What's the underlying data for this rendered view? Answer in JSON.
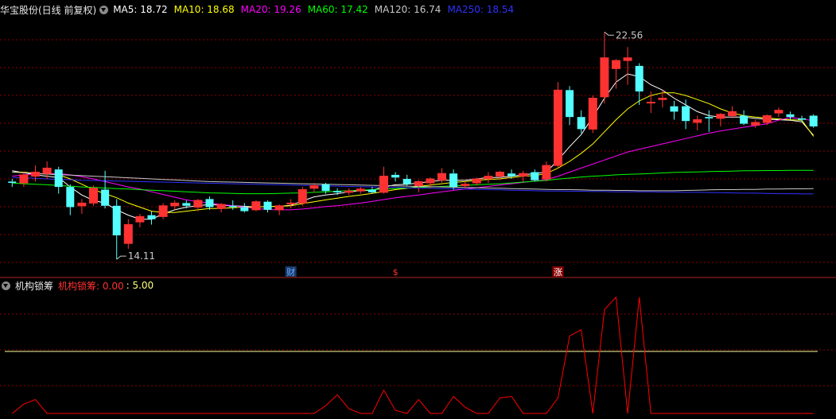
{
  "header": {
    "title": "华宝股份(日线 前复权)",
    "ma": [
      {
        "label": "MA5: 18.72",
        "color": "#ffffff"
      },
      {
        "label": "MA10: 18.68",
        "color": "#ffff00"
      },
      {
        "label": "MA20: 19.26",
        "color": "#ff00ff"
      },
      {
        "label": "MA60: 17.42",
        "color": "#00ff00"
      },
      {
        "label": "MA120: 16.74",
        "color": "#c8c8c8"
      },
      {
        "label": "MA250: 18.54",
        "color": "#3030ff"
      }
    ]
  },
  "annotations": {
    "high": "22.56",
    "low": "14.11",
    "markers": [
      "财",
      "$",
      "涨"
    ]
  },
  "indicator": {
    "name": "机构锁筹",
    "value_label": "机构锁筹: 0.00",
    "ref_label": ": 5.00"
  },
  "colors": {
    "up": "#ff3232",
    "down": "#54ffff",
    "grid": "#8b0000",
    "divider": "#b22222",
    "ind_line": "#ff0000",
    "ref_line": "#ffff99"
  },
  "chart_data": [
    {
      "type": "candlestick",
      "title": "华宝股份(日线 前复权)",
      "ohlc": [
        [
          17.0,
          17.1,
          16.8,
          16.95
        ],
        [
          16.95,
          17.35,
          16.8,
          17.25
        ],
        [
          17.2,
          17.6,
          17.0,
          17.35
        ],
        [
          17.3,
          17.75,
          17.1,
          17.5
        ],
        [
          17.45,
          17.55,
          16.55,
          16.8
        ],
        [
          16.8,
          16.9,
          15.75,
          16.05
        ],
        [
          16.1,
          16.35,
          15.8,
          16.2
        ],
        [
          16.2,
          16.85,
          16.1,
          16.75
        ],
        [
          16.7,
          17.4,
          16.0,
          16.1
        ],
        [
          16.1,
          16.35,
          14.11,
          15.0
        ],
        [
          14.7,
          15.6,
          14.5,
          15.4
        ],
        [
          15.5,
          15.8,
          15.3,
          15.7
        ],
        [
          15.75,
          15.9,
          15.4,
          15.6
        ],
        [
          15.7,
          16.2,
          15.6,
          16.1
        ],
        [
          16.1,
          16.3,
          15.95,
          16.2
        ],
        [
          16.2,
          16.3,
          16.0,
          16.1
        ],
        [
          16.05,
          16.35,
          15.9,
          16.3
        ],
        [
          16.35,
          16.45,
          15.95,
          16.05
        ],
        [
          16.0,
          16.2,
          15.85,
          16.15
        ],
        [
          16.1,
          16.3,
          15.95,
          16.05
        ],
        [
          16.05,
          16.2,
          15.85,
          15.9
        ],
        [
          15.95,
          16.3,
          15.9,
          16.25
        ],
        [
          16.25,
          16.3,
          15.85,
          15.95
        ],
        [
          15.95,
          16.15,
          15.75,
          16.1
        ],
        [
          16.2,
          16.35,
          16.0,
          16.2
        ],
        [
          16.2,
          16.8,
          16.1,
          16.7
        ],
        [
          16.75,
          16.95,
          16.6,
          16.85
        ],
        [
          16.9,
          16.95,
          16.55,
          16.65
        ],
        [
          16.65,
          16.75,
          16.5,
          16.6
        ],
        [
          16.6,
          16.75,
          16.5,
          16.65
        ],
        [
          16.65,
          16.8,
          16.55,
          16.72
        ],
        [
          16.7,
          16.8,
          16.55,
          16.6
        ],
        [
          16.6,
          17.55,
          16.55,
          17.2
        ],
        [
          17.25,
          17.35,
          17.0,
          17.15
        ],
        [
          17.1,
          17.25,
          16.85,
          16.9
        ],
        [
          16.85,
          17.05,
          16.6,
          17.0
        ],
        [
          16.95,
          17.15,
          16.75,
          17.1
        ],
        [
          17.05,
          17.5,
          16.95,
          17.3
        ],
        [
          17.3,
          17.45,
          16.7,
          16.8
        ],
        [
          16.85,
          17.0,
          16.75,
          16.9
        ],
        [
          16.95,
          17.15,
          16.85,
          17.1
        ],
        [
          17.1,
          17.35,
          16.95,
          17.2
        ],
        [
          17.2,
          17.4,
          17.05,
          17.35
        ],
        [
          17.3,
          17.45,
          17.1,
          17.2
        ],
        [
          17.2,
          17.4,
          17.0,
          17.3
        ],
        [
          17.35,
          17.45,
          17.0,
          17.05
        ],
        [
          17.1,
          17.75,
          17.0,
          17.6
        ],
        [
          17.6,
          20.7,
          17.5,
          20.4
        ],
        [
          20.4,
          20.55,
          19.1,
          19.4
        ],
        [
          19.4,
          19.65,
          18.8,
          18.95
        ],
        [
          18.95,
          20.2,
          18.8,
          20.1
        ],
        [
          20.15,
          22.56,
          19.9,
          21.6
        ],
        [
          21.2,
          21.55,
          20.45,
          21.5
        ],
        [
          21.5,
          22.0,
          20.6,
          21.6
        ],
        [
          21.3,
          21.4,
          19.85,
          20.35
        ],
        [
          19.95,
          20.35,
          19.55,
          19.95
        ],
        [
          20.05,
          20.4,
          19.75,
          20.1
        ],
        [
          19.8,
          20.0,
          19.3,
          19.6
        ],
        [
          19.8,
          20.05,
          18.95,
          19.25
        ],
        [
          19.2,
          19.45,
          18.9,
          19.3
        ],
        [
          19.4,
          19.65,
          18.85,
          19.35
        ],
        [
          19.35,
          19.55,
          19.05,
          19.5
        ],
        [
          19.45,
          19.8,
          19.35,
          19.6
        ],
        [
          19.45,
          19.65,
          19.1,
          19.15
        ],
        [
          19.1,
          19.3,
          19.0,
          19.2
        ],
        [
          19.2,
          19.5,
          19.1,
          19.45
        ],
        [
          19.55,
          19.75,
          19.4,
          19.65
        ],
        [
          19.5,
          19.6,
          19.3,
          19.4
        ],
        [
          19.35,
          19.45,
          19.2,
          19.3
        ],
        [
          19.45,
          19.5,
          19.0,
          19.05
        ]
      ],
      "ma_lines": {
        "MA5": [
          17.4,
          17.33,
          17.25,
          17.2,
          17.15,
          16.8,
          16.5,
          16.3,
          16.2,
          15.95,
          15.75,
          15.6,
          15.6,
          15.8,
          15.95,
          16.05,
          16.1,
          16.15,
          16.12,
          16.1,
          16.08,
          16.06,
          16.07,
          16.08,
          16.12,
          16.28,
          16.43,
          16.5,
          16.55,
          16.62,
          16.66,
          16.68,
          16.8,
          16.88,
          16.9,
          16.95,
          17.0,
          17.05,
          17.05,
          17.05,
          17.1,
          17.15,
          17.15,
          17.2,
          17.25,
          17.3,
          17.35,
          17.8,
          18.3,
          18.75,
          19.4,
          20.1,
          20.7,
          21.0,
          20.9,
          20.6,
          20.4,
          20.1,
          19.85,
          19.6,
          19.45,
          19.4,
          19.4,
          19.4,
          19.35,
          19.32,
          19.3,
          19.28,
          19.22,
          18.72
        ],
        "MA10": [
          17.35,
          17.35,
          17.3,
          17.28,
          17.25,
          17.1,
          16.9,
          16.7,
          16.55,
          16.4,
          16.2,
          16.05,
          15.9,
          15.85,
          15.85,
          15.9,
          15.95,
          16.0,
          16.0,
          16.03,
          16.05,
          16.06,
          16.07,
          16.08,
          16.1,
          16.18,
          16.25,
          16.32,
          16.38,
          16.45,
          16.5,
          16.56,
          16.63,
          16.7,
          16.75,
          16.82,
          16.87,
          16.92,
          16.97,
          17.0,
          17.05,
          17.08,
          17.1,
          17.15,
          17.2,
          17.22,
          17.3,
          17.5,
          17.75,
          18.05,
          18.4,
          18.85,
          19.3,
          19.7,
          20.0,
          20.2,
          20.3,
          20.3,
          20.2,
          20.05,
          19.9,
          19.7,
          19.55,
          19.45,
          19.4,
          19.36,
          19.33,
          19.3,
          19.28,
          18.68
        ],
        "MA20": [
          17.2,
          17.25,
          17.28,
          17.3,
          17.3,
          17.25,
          17.18,
          17.1,
          17.0,
          16.9,
          16.8,
          16.72,
          16.62,
          16.52,
          16.42,
          16.32,
          16.25,
          16.2,
          16.15,
          16.1,
          16.05,
          16.0,
          15.96,
          15.95,
          15.95,
          15.98,
          16.02,
          16.07,
          16.1,
          16.15,
          16.2,
          16.26,
          16.33,
          16.4,
          16.45,
          16.5,
          16.56,
          16.62,
          16.67,
          16.72,
          16.77,
          16.82,
          16.87,
          16.92,
          16.97,
          17.02,
          17.07,
          17.2,
          17.35,
          17.5,
          17.65,
          17.8,
          17.95,
          18.1,
          18.2,
          18.3,
          18.4,
          18.5,
          18.6,
          18.7,
          18.8,
          18.88,
          18.95,
          19.02,
          19.08,
          19.15,
          19.28,
          19.38,
          19.33,
          19.26
        ],
        "MA60": [
          16.95,
          16.92,
          16.9,
          16.88,
          16.85,
          16.83,
          16.8,
          16.78,
          16.76,
          16.74,
          16.72,
          16.7,
          16.68,
          16.66,
          16.64,
          16.62,
          16.6,
          16.58,
          16.57,
          16.56,
          16.55,
          16.55,
          16.55,
          16.56,
          16.57,
          16.58,
          16.6,
          16.62,
          16.64,
          16.66,
          16.68,
          16.7,
          16.72,
          16.74,
          16.76,
          16.78,
          16.8,
          16.82,
          16.84,
          16.86,
          16.88,
          16.9,
          16.92,
          16.95,
          16.98,
          17.01,
          17.05,
          17.09,
          17.13,
          17.17,
          17.2,
          17.22,
          17.25,
          17.27,
          17.28,
          17.3,
          17.32,
          17.34,
          17.35,
          17.36,
          17.37,
          17.38,
          17.39,
          17.4,
          17.4,
          17.41,
          17.41,
          17.42,
          17.42,
          17.42
        ],
        "MA120": [
          17.35,
          17.33,
          17.3,
          17.28,
          17.26,
          17.24,
          17.22,
          17.2,
          17.18,
          17.16,
          17.14,
          17.12,
          17.1,
          17.08,
          17.06,
          17.04,
          17.02,
          17.0,
          16.99,
          16.98,
          16.97,
          16.96,
          16.95,
          16.94,
          16.93,
          16.92,
          16.91,
          16.9,
          16.89,
          16.88,
          16.87,
          16.86,
          16.85,
          16.84,
          16.83,
          16.82,
          16.81,
          16.8,
          16.79,
          16.78,
          16.77,
          16.76,
          16.75,
          16.74,
          16.73,
          16.72,
          16.71,
          16.7,
          16.7,
          16.69,
          16.68,
          16.68,
          16.67,
          16.67,
          16.66,
          16.66,
          16.66,
          16.66,
          16.67,
          16.68,
          16.69,
          16.7,
          16.7,
          16.71,
          16.71,
          16.72,
          16.72,
          16.73,
          16.73,
          16.74
        ],
        "MA250": [
          17.15,
          17.14,
          17.12,
          17.1,
          17.08,
          17.07,
          17.05,
          17.04,
          17.03,
          17.02,
          17.01,
          17.0,
          16.99,
          16.98,
          16.97,
          16.96,
          16.95,
          16.94,
          16.93,
          16.92,
          16.91,
          16.9,
          16.89,
          16.88,
          16.87,
          16.86,
          16.85,
          16.84,
          16.83,
          16.82,
          16.81,
          16.8,
          16.79,
          16.78,
          16.77,
          16.76,
          16.75,
          16.74,
          16.73,
          16.72,
          16.71,
          16.7,
          16.69,
          16.68,
          16.67,
          16.66,
          16.65,
          16.65,
          16.64,
          16.64,
          16.63,
          16.63,
          16.62,
          16.62,
          16.62,
          16.62,
          16.61,
          16.61,
          16.6,
          16.6,
          16.59,
          16.59,
          16.58,
          16.57,
          16.57,
          16.56,
          16.55,
          16.55,
          16.54,
          16.54
        ]
      },
      "ylim": [
        13.7,
        23.1
      ]
    },
    {
      "type": "line",
      "title": "机构锁筹",
      "series": [
        {
          "name": "机构锁筹",
          "values": [
            0,
            0.6,
            0.9,
            0,
            0,
            0,
            0,
            0,
            0,
            0,
            0,
            0,
            0,
            0,
            0,
            0,
            0,
            0,
            0,
            0,
            0,
            0,
            0,
            0,
            0,
            0,
            0,
            0.5,
            1.2,
            0.3,
            0,
            0,
            1.5,
            0.2,
            0,
            0.9,
            0,
            0,
            1.1,
            0.4,
            0,
            0,
            1.0,
            1.1,
            0,
            0,
            0,
            1.0,
            5.0,
            5.4,
            0,
            6.7,
            7.5,
            0,
            7.5,
            0,
            0,
            0,
            0,
            0,
            0,
            0,
            0,
            0,
            0,
            0,
            0,
            0,
            0,
            0
          ]
        },
        {
          "name": "reference",
          "values": [
            4.0,
            4.0,
            4.0,
            4.0,
            4.0,
            4.0,
            4.0,
            4.0,
            4.0,
            4.0,
            4.0,
            4.0,
            4.0,
            4.0,
            4.0,
            4.0,
            4.0,
            4.0,
            4.0,
            4.0,
            4.0,
            4.0,
            4.0,
            4.0,
            4.0,
            4.0,
            4.0,
            4.0,
            4.0,
            4.0,
            4.0,
            4.0,
            4.0,
            4.0,
            4.0,
            4.0,
            4.0,
            4.0,
            4.0,
            4.0,
            4.0,
            4.0,
            4.0,
            4.0,
            4.0,
            4.0,
            4.0,
            4.0,
            4.0,
            4.0,
            4.0,
            4.0,
            4.0,
            4.0,
            4.0,
            4.0,
            4.0,
            4.0,
            4.0,
            4.0,
            4.0,
            4.0,
            4.0,
            4.0,
            4.0,
            4.0,
            4.0,
            4.0,
            4.0,
            4.0
          ]
        }
      ],
      "ylim": [
        0,
        7.8
      ]
    }
  ]
}
